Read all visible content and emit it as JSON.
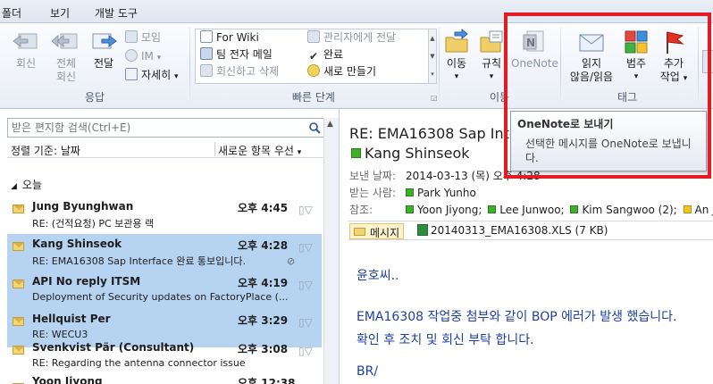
{
  "menu": {
    "tabs": [
      "폴더",
      "보기",
      "개발 도구"
    ]
  },
  "ribbon": {
    "respond": {
      "label": "응답",
      "reply": "회신",
      "reply_all_line1": "전체",
      "reply_all_line2": "회신",
      "forward": "전달",
      "meeting": "모임",
      "im": "IM",
      "more": "자세히"
    },
    "quicksteps": {
      "label": "빠른 단계",
      "items": [
        "For Wiki",
        "팀 전자 메일",
        "회신하고 삭제",
        "관리자에게 전달",
        "완료",
        "새로 만들기"
      ]
    },
    "move": {
      "label": "이동",
      "move": "이동",
      "rules": "규칙",
      "onenote": "OneNote"
    },
    "tags": {
      "label": "태그",
      "read_unread_line1": "읽지",
      "read_unread_line2": "않음/읽음",
      "categorize": "범주",
      "followup_line1": "추가",
      "followup_line2": "작업"
    }
  },
  "tooltip": {
    "title": "OneNote로 보내기",
    "body": "선택한 메시지를 OneNote로 보냅니다."
  },
  "list": {
    "search_placeholder": "받은 편지함 검색(Ctrl+E)",
    "sort_label": "정렬 기준: 날짜",
    "sort_order": "새로운 항목 우선",
    "group": "오늘",
    "items": [
      {
        "sender": "Jung Byunghwan",
        "time": "오후 4:45",
        "subject": "RE: (건적요청) PC 보관용 랙",
        "selected": false
      },
      {
        "sender": "Kang Shinseok",
        "time": "오후 4:28",
        "subject": "RE: EMA16308 Sap Interface 완료 통보입니다.",
        "selected": true
      },
      {
        "sender": "API No reply ITSM",
        "time": "오후 4:19",
        "subject": "Deployment of Security updates on FactoryPlace (...",
        "selected": true
      },
      {
        "sender": "Hellquist Per",
        "time": "오후 3:29",
        "subject": "RE: WECU3",
        "selected": true
      },
      {
        "sender": "Svenkvist Pär (Consultant)",
        "time": "오후 3:08",
        "subject": "RE: Regarding the antenna connector issue",
        "selected": false
      },
      {
        "sender": "Yoon Jiyong",
        "time": "오후 12:38",
        "subject": "",
        "selected": false
      }
    ]
  },
  "reading": {
    "subject": "RE: EMA16308 Sap Interface 완료 통보입니다.",
    "sender": "Kang Shinseok",
    "sent_label": "보낸 날짜:",
    "sent_value": "2014-03-13 (목) 오후 4:28",
    "to_label": "받는 사람:",
    "to_value": "Park Yunho",
    "cc_label": "참조:",
    "cc": [
      "Yoon Jiyong;",
      "Lee Junwoo;",
      "Kim Sangwoo (2);",
      "An J"
    ],
    "message_tab": "메시지",
    "attachment": "20140313_EMA16308.XLS (7 KB)",
    "body": [
      "윤호씨..",
      "EMA16308 작업중 첨부와 같이 BOP 에러가 발생 했습니다.",
      "확인 후 조치 및 회신 부탁 합니다.",
      "BR/"
    ]
  }
}
